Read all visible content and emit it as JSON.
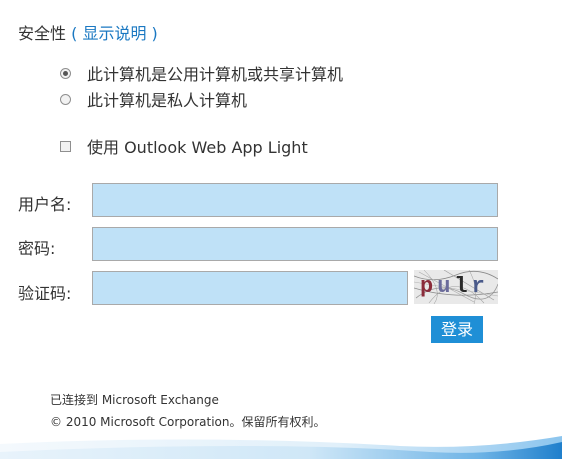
{
  "security": {
    "title": "安全性",
    "paren_open": " ( ",
    "link": "显示说明",
    "paren_close": " )",
    "options": [
      {
        "label": "此计算机是公用计算机或共享计算机",
        "selected": true
      },
      {
        "label": "此计算机是私人计算机",
        "selected": false
      }
    ]
  },
  "light_option": {
    "label": "使用 Outlook Web App Light",
    "checked": false
  },
  "form": {
    "username_label": "用户名:",
    "username_value": "",
    "password_label": "密码:",
    "password_value": "",
    "captcha_label": "验证码:",
    "captcha_value": "",
    "captcha_text": "pulr",
    "login_button": "登录"
  },
  "footer": {
    "connected": "已连接到 Microsoft Exchange",
    "copyright": "© 2010 Microsoft Corporation。保留所有权利。"
  },
  "colors": {
    "accent": "#1f8fd6",
    "link": "#1a78c2",
    "field_bg": "#bfe1f7"
  }
}
